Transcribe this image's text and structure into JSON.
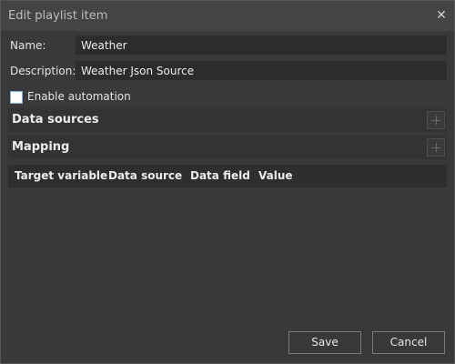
{
  "window": {
    "title": "Edit playlist item",
    "close_glyph": "✕"
  },
  "form": {
    "name_label": "Name:",
    "name_value": "Weather",
    "description_label": "Description:",
    "description_value": "Weather Json Source",
    "automation_label": "Enable automation",
    "automation_checked": false
  },
  "sections": {
    "data_sources": {
      "title": "Data sources",
      "add_icon": "plus-icon"
    },
    "mapping": {
      "title": "Mapping",
      "add_icon": "plus-icon"
    }
  },
  "table": {
    "columns": [
      "Target variable",
      "Data source",
      "Data field",
      "Value"
    ],
    "rows": []
  },
  "buttons": {
    "save": "Save",
    "cancel": "Cancel"
  }
}
